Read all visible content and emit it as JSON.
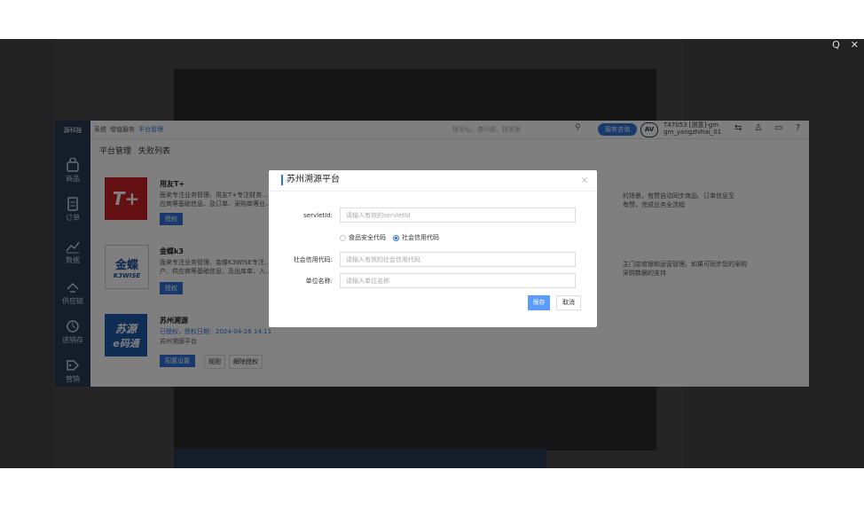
{
  "viewer": {
    "zoom_icon": "zoom-icon",
    "close_icon": "close-icon",
    "zoom_glyph": "Q",
    "close_glyph": "✕"
  },
  "app": {
    "brand": "源科技",
    "breadcrumb": [
      "系统",
      "增值服务",
      "平台管理"
    ],
    "search_placeholder": "搜论坛、查问题、找答案",
    "top_button": "服务咨询",
    "avatar_text": "AV",
    "user_line1": "T47053 [测意]-gm",
    "user_line2": "gm_yangzhihai_01",
    "sidebar": [
      {
        "label": "商品",
        "icon": "bag-icon"
      },
      {
        "label": "订单",
        "icon": "order-icon"
      },
      {
        "label": "数据",
        "icon": "chart-icon"
      },
      {
        "label": "供应链",
        "icon": "supply-icon"
      },
      {
        "label": "进销存",
        "icon": "inventory-icon"
      },
      {
        "label": "营销",
        "icon": "tag-icon"
      }
    ],
    "tabs": [
      "平台管理",
      "失败列表"
    ],
    "cards": [
      {
        "title": "用友T+",
        "desc1": "面来专注业务管理、用友T+专注财务...",
        "desc2": "应商等基础信息、及订单、采购单等业...",
        "button": "授权",
        "logo": "T+"
      },
      {
        "title": "金蝶k3",
        "desc1": "面来专注业务管理、金蝶K3WISE专注...",
        "desc2": "户、供应商等基础信息、及出库单、入...",
        "button": "授权",
        "logo": "金蝶",
        "logo_sub": "K3WISE"
      },
      {
        "title": "苏州溯源",
        "desc1": "已授权，授权日期：2024-04-26 14:11",
        "desc2": "苏州溯源平台",
        "button": "配置设置",
        "link1": "规则",
        "link2": "解除授权",
        "logo": "苏源",
        "logo_sub": "e码通"
      }
    ],
    "right_texts": [
      "的场景，有赞自动同步商品、订单信息至",
      "有赞，完成业务全流程",
      "主门店收银和运营管理。如果可同步您的采购",
      "采购数据的支持"
    ]
  },
  "modal": {
    "title": "苏州溯源平台",
    "close": "×",
    "servletId_label": "servletId:",
    "servletId_placeholder": "请输入有效的servletId",
    "radio_options": [
      "食品安全代码",
      "社会信用代码"
    ],
    "radio_selected": "社会信用代码",
    "credit_label": "社会信用代码:",
    "credit_placeholder": "请输入有效的社会信用代码",
    "unit_label": "单位名称:",
    "unit_placeholder": "请输入单位名称",
    "save": "保存",
    "cancel": "取消"
  },
  "colors": {
    "accent": "#2f73d9",
    "save_button": "#5b9bff",
    "sidebar": "#2b3a55"
  }
}
